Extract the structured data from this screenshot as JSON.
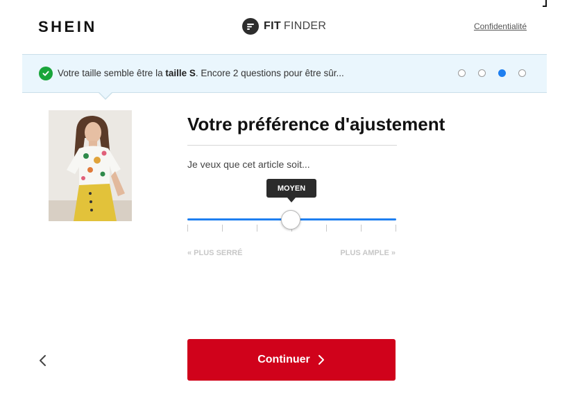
{
  "header": {
    "brand": "SHEIN",
    "widget_bold": "FIT",
    "widget_light": "FINDER",
    "privacy_link": "Confidentialité"
  },
  "banner": {
    "text_prefix": "Votre taille semble être la ",
    "size_bold": "taille S",
    "text_suffix": ". Encore 2 questions pour être sûr...",
    "progress": {
      "total_steps": 4,
      "current_step": 3
    }
  },
  "product": {
    "image_icon": "product-photo"
  },
  "question": {
    "title": "Votre préférence d'ajustement",
    "subtitle": "Je veux que cet article soit..."
  },
  "slider": {
    "value_label": "MOYEN",
    "min_label": "« PLUS SERRÉ",
    "max_label": "PLUS AMPLE »",
    "steps": 7,
    "selected_index": 3
  },
  "nav": {
    "continue_label": "Continuer",
    "back_icon": "chevron-left-icon",
    "next_icon": "chevron-right-icon"
  },
  "colors": {
    "accent_blue": "#1e7ff0",
    "primary_red": "#d0021b",
    "banner_bg": "#eaf6fd",
    "success_green": "#19a53a"
  }
}
